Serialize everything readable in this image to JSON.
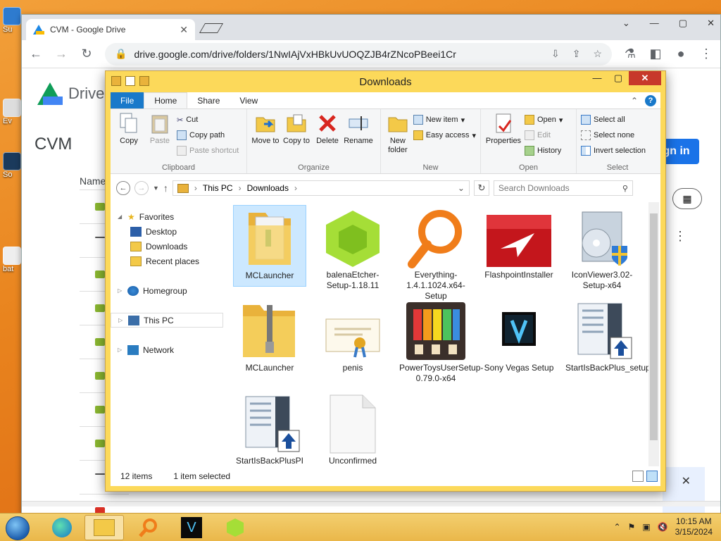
{
  "desktop": {
    "icons": [
      "Su",
      "Ev",
      "So",
      "bat"
    ]
  },
  "chrome": {
    "tab_title": "CVM - Google Drive",
    "url": "drive.google.com/drive/folders/1NwIAjVxHBkUvUOQZJB4rZNcoPBeei1Cr",
    "page": {
      "logo_text": "Drive",
      "folder": "CVM",
      "name_col": "Name",
      "signin_label": "Sign in"
    }
  },
  "explorer": {
    "title": "Downloads",
    "tabs": [
      "File",
      "Home",
      "Share",
      "View"
    ],
    "ribbon": {
      "clipboard": {
        "label": "Clipboard",
        "copy": "Copy",
        "paste": "Paste",
        "cut": "Cut",
        "copy_path": "Copy path",
        "paste_shortcut": "Paste shortcut"
      },
      "organize": {
        "label": "Organize",
        "move_to": "Move to",
        "copy_to": "Copy to",
        "delete": "Delete",
        "rename": "Rename"
      },
      "new": {
        "label": "New",
        "new_folder": "New folder",
        "new_item": "New item",
        "easy_access": "Easy access"
      },
      "open": {
        "label": "Open",
        "properties": "Properties",
        "open": "Open",
        "edit": "Edit",
        "history": "History"
      },
      "select": {
        "label": "Select",
        "select_all": "Select all",
        "select_none": "Select none",
        "invert": "Invert selection"
      }
    },
    "path": [
      "This PC",
      "Downloads"
    ],
    "search_placeholder": "Search Downloads",
    "nav": {
      "favorites": "Favorites",
      "desktop": "Desktop",
      "downloads": "Downloads",
      "recent": "Recent places",
      "homegroup": "Homegroup",
      "this_pc": "This PC",
      "network": "Network"
    },
    "files": [
      {
        "name": "MCLauncher",
        "icon": "folder-icon"
      },
      {
        "name": "balenaEtcher-Setup-1.18.11",
        "icon": "balena-icon"
      },
      {
        "name": "Everything-1.4.1.1024.x64-Setup",
        "icon": "magnifier-icon"
      },
      {
        "name": "FlashpointInstaller",
        "icon": "flashpoint-icon"
      },
      {
        "name": "IconViewer3.02-Setup-x64",
        "icon": "installer-icon"
      },
      {
        "name": "MCLauncher",
        "icon": "zip-folder-icon"
      },
      {
        "name": "penis",
        "icon": "certificate-icon"
      },
      {
        "name": "PowerToysUserSetup-0.79.0-x64",
        "icon": "powertoys-icon"
      },
      {
        "name": "Sony Vegas Setup",
        "icon": "vegas-icon"
      },
      {
        "name": "StartIsBackPlus_setup",
        "icon": "startisback-icon"
      },
      {
        "name": "StartIsBackPlusPI",
        "icon": "startisback-icon"
      },
      {
        "name": "Unconfirmed",
        "icon": "blank-file-icon"
      }
    ],
    "status": {
      "count": "12 items",
      "selected": "1 item selected"
    }
  },
  "taskbar": {
    "time": "10:15 AM",
    "date": "3/15/2024"
  }
}
